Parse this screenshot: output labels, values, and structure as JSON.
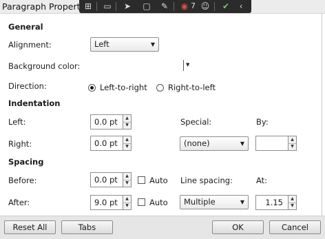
{
  "window": {
    "title": "Paragraph Properti",
    "toolbar_icons": [
      "add-marker-icon",
      "video-icon",
      "cursor-icon",
      "frame-icon",
      "pen-icon",
      "record-icon",
      "accessibility-icon",
      "check-icon",
      "collapse-arrow-icon"
    ],
    "record_count": "7"
  },
  "general": {
    "heading": "General",
    "alignment_label": "Alignment:",
    "alignment_value": "Left",
    "background_label": "Background color:",
    "direction_label": "Direction:",
    "direction_ltr": "Left-to-right",
    "direction_rtl": "Right-to-left",
    "direction_selected": "Left-to-right"
  },
  "indentation": {
    "heading": "Indentation",
    "left_label": "Left:",
    "left_value": "0.0 pt",
    "right_label": "Right:",
    "right_value": "0.0 pt",
    "special_label": "Special:",
    "special_value": "(none)",
    "by_label": "By:",
    "by_value": ""
  },
  "spacing": {
    "heading": "Spacing",
    "before_label": "Before:",
    "before_value": "0.0 pt",
    "before_auto": "Auto",
    "after_label": "After:",
    "after_value": "9.0 pt",
    "after_auto": "Auto",
    "line_spacing_label": "Line spacing:",
    "line_spacing_value": "Multiple",
    "at_label": "At:",
    "at_value": "1.15"
  },
  "buttons": {
    "reset_all": "Reset All",
    "tabs": "Tabs",
    "ok": "OK",
    "cancel": "Cancel"
  }
}
